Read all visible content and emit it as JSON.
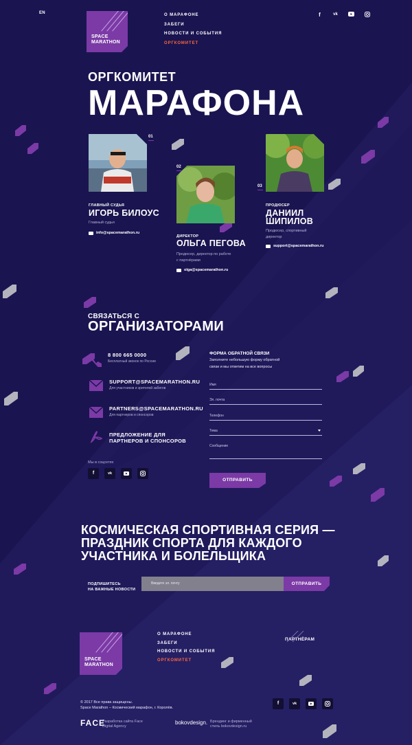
{
  "header": {
    "lang": "EN",
    "logo_line1": "SPACE",
    "logo_line2": "MARATHON",
    "nav": [
      "О МАРАФОНЕ",
      "ЗАБЕГИ",
      "НОВОСТИ И СОБЫТИЯ",
      "ОРГКОМИТЕТ"
    ],
    "active_nav": "ОРГКОМИТЕТ",
    "social_icons": [
      "facebook-icon",
      "vk-icon",
      "youtube-icon",
      "instagram-icon"
    ]
  },
  "hero": {
    "title_small": "ОРГКОМИТЕТ",
    "title_big": "МАРАФОНА"
  },
  "persons": [
    {
      "num": "01",
      "role": "ГЛАВНЫЙ СУДЬЯ",
      "name": "ИГОРЬ БИЛОУС",
      "desc": "Главный судья",
      "email": "info@spacemarathon.ru"
    },
    {
      "num": "02",
      "role": "ДИРЕКТОР",
      "name": "ОЛЬГА ПЕГОВА",
      "desc_line1": "Продюсер, директор по работе",
      "desc_line2": "с партнёрами",
      "email": "olga@spacemarathon.ru"
    },
    {
      "num": "03",
      "role": "ПРОДЮСЕР",
      "name_line1": "ДАНИИЛ",
      "name_line2": "ШИПИЛОВ",
      "desc_line1": "Продюсер, спортивный",
      "desc_line2": "директор",
      "email": "support@spacemarathon.ru"
    }
  ],
  "contacts": {
    "title_small": "СВЯЗАТЬСЯ С",
    "title_big": "ОРГАНИЗАТОРАМИ",
    "items": [
      {
        "icon": "phone-icon",
        "value": "8 800 665 0000",
        "sub": "Бесплатный звонок по России"
      },
      {
        "icon": "envelope-icon",
        "value": "SUPPORT@SPACEMARATHON.RU",
        "sub": "Для участников и зрителей забегов"
      },
      {
        "icon": "envelope-icon",
        "value": "PARTNERS@SPACEMARATHON.RU",
        "sub": "Для партнеров и спонсоров"
      },
      {
        "icon": "pdf-icon",
        "value_line1": "ПРЕДЛОЖЕНИЕ ДЛЯ",
        "value_line2": "ПАРТНЕРОВ И СПОНСОРОВ"
      }
    ],
    "follow_label": "Мы в соцсетях"
  },
  "form": {
    "title": "ФОРМА ОБРАТНОЙ СВЯЗИ",
    "sub_line1": "Заполните небольшую форму обратной",
    "sub_line2": "связи и мы ответим на все вопросы",
    "placeholders": {
      "name": "Имя",
      "email": "Эл. почта",
      "phone": "Телефон",
      "topic": "Тема",
      "message": "Сообщение"
    },
    "submit": "ОТПРАВИТЬ"
  },
  "slogan": {
    "line1": "КОСМИЧЕСКАЯ СПОРТИВНАЯ СЕРИЯ —",
    "line2": "ПРАЗДНИК СПОРТА ДЛЯ КАЖДОГО",
    "line3": "УЧАСТНИКА И БОЛЕЛЬЩИКА"
  },
  "subscribe": {
    "label_line1": "ПОДПИШИТЕСЬ",
    "label_line2": "НА ВАЖНЫЕ НОВОСТИ",
    "placeholder": "Введите эл. почту",
    "button": "ОТПРАВИТЬ"
  },
  "footer": {
    "nav": [
      "О МАРАФОНЕ",
      "ЗАБЕГИ",
      "НОВОСТИ И СОБЫТИЯ",
      "ОРГКОМИТЕТ"
    ],
    "partners": "ПАРТНЁРАМ",
    "copyright_line1": "© 2017 Все права защищены.",
    "copyright_line2": "Space Marathon – Космический марафон, г. Королёв.",
    "face_logo": "FACE",
    "face_text_line1": "Разработка сайта Face",
    "face_text_line2": "Digital Agency",
    "bokov_logo": "bokovdesign.",
    "bokov_text_line1": "Брендинг и фирменный",
    "bokov_text_line2": "стиль bokovdesign.ru"
  },
  "colors": {
    "bg_dark": "#1a1450",
    "bg_mid": "#221c5e",
    "accent": "#7b3aa6",
    "active_nav": "#ff6a3d"
  }
}
